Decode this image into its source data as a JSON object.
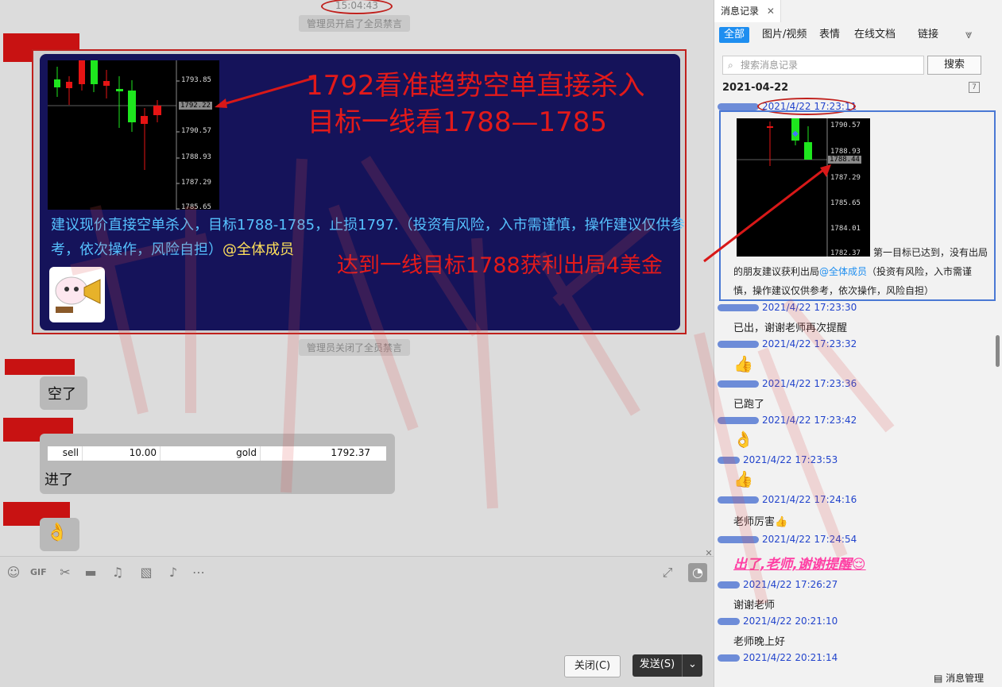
{
  "chat": {
    "time": "15:04:43",
    "sys_mute_on": "管理员开启了全员禁言",
    "sys_mute_off": "管理员关闭了全员禁言",
    "teacher_annotation_line1": "1792看准趋势空单直接杀入",
    "teacher_annotation_line2": "目标一线看1788—1785",
    "teacher_annotation_profit": "达到一线目标1788获利出局4美金",
    "advice_text": "建议现价直接空单杀入，目标1788-1785，止损1797.（投资有风险，入市需谨慎，操作建议仅供参考，依次操作，风险自担）",
    "advice_at": "@全体成员",
    "chart1_prices": [
      "1793.85",
      "1792.22",
      "1790.57",
      "1788.93",
      "1787.29",
      "1785.65"
    ],
    "msg_short": "空了",
    "trade_row": {
      "side": "sell",
      "lots": "10.00",
      "symbol": "gold",
      "price": "1792.37"
    },
    "msg_entered": "进了",
    "msg_ok_emoji": "👌"
  },
  "toolbar": {
    "icons": [
      "smiley-icon",
      "gif-icon",
      "scissors-icon",
      "folder-icon",
      "shake-icon",
      "image-icon",
      "bell-icon",
      "more-icon"
    ],
    "close_label": "关闭(C)",
    "send_label": "发送(S)"
  },
  "history": {
    "tab_label": "消息记录",
    "filters": [
      "全部",
      "图片/视频",
      "表情",
      "在线文档",
      "链接"
    ],
    "search_placeholder": "搜索消息记录",
    "search_button": "搜索",
    "date": "2021-04-22",
    "chart2_prices": [
      "1790.57",
      "1788.93",
      "1788.44",
      "1787.29",
      "1785.65",
      "1784.01",
      "1782.37"
    ],
    "entries": [
      {
        "time": "2021/4/22 17:23:11",
        "text": "第一目标已达到，没有出局的朋友建议获利出局",
        "at": "@全体成员",
        "text2": "（投资有风险，入市需谨慎，操作建议仅供参考，依次操作，风险自担）"
      },
      {
        "time": "2021/4/22 17:23:30",
        "text": "已出，谢谢老师再次提醒"
      },
      {
        "time": "2021/4/22 17:23:32",
        "text": "👍"
      },
      {
        "time": "2021/4/22 17:23:36",
        "text": "已跑了"
      },
      {
        "time": "2021/4/22 17:23:42",
        "text": "👌"
      },
      {
        "time": "2021/4/22 17:23:53",
        "text": "👍"
      },
      {
        "time": "2021/4/22 17:24:16",
        "text": "老师厉害👍"
      },
      {
        "time": "2021/4/22 17:24:54",
        "text": "出了,老师,谢谢提醒😌"
      },
      {
        "time": "2021/4/22 17:26:27",
        "text": "谢谢老师"
      },
      {
        "time": "2021/4/22 20:21:10",
        "text": "老师晚上好"
      },
      {
        "time": "2021/4/22 20:21:14",
        "text": ""
      }
    ],
    "msg_manage": "消息管理"
  },
  "colors": {
    "accent": "#1e8ef0",
    "annotation_red": "#e21a1a",
    "panel_navy": "#15135a",
    "bull_green": "#1ee61e",
    "bear_red": "#e61414"
  }
}
